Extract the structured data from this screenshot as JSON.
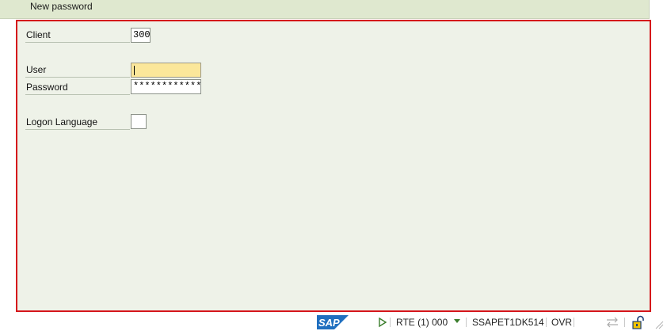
{
  "toolbar": {
    "new_password_label": "New password"
  },
  "form": {
    "client": {
      "label": "Client",
      "value": "300"
    },
    "user": {
      "label": "User",
      "value": ""
    },
    "password": {
      "label": "Password",
      "value": "************"
    },
    "logon_language": {
      "label": "Logon Language",
      "value": ""
    }
  },
  "statusbar": {
    "logo_text": "SAP",
    "system": "RTE (1) 000",
    "server": "SSAPET1DK514",
    "mode": "OVR",
    "icons": [
      "play-arrow-icon",
      "dropdown-icon",
      "transfer-icon",
      "lock-icon",
      "resize-grip-icon"
    ]
  },
  "colors": {
    "toolbar_bg": "#dfe8cf",
    "content_bg": "#eef2e8",
    "focus_border": "#d5151b",
    "focused_field_bg": "#fbe79a",
    "sap_blue": "#1f6fbf"
  }
}
